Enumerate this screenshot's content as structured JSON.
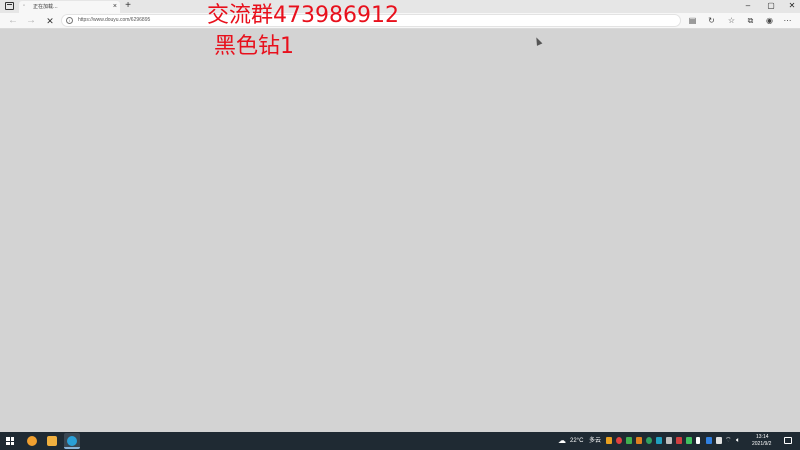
{
  "browser": {
    "tab_title": "正在加载...",
    "tab_close": "×",
    "new_tab": "+",
    "url": "https://www.douyu.com/6296895",
    "window_buttons": {
      "minimize": "–",
      "maximize": "▢",
      "close": "✕"
    },
    "nav": {
      "back": "←",
      "forward": "→",
      "stop": "✕"
    }
  },
  "overlay": {
    "line1": "交流群473986912",
    "line2": "黑色钻1"
  },
  "taskbar": {
    "weather": "22°C",
    "weather_desc": "多云",
    "time": "13:14",
    "date": "2021/9/2"
  },
  "colors": {
    "overlay_text": "#e8101c",
    "page_bg": "#d3d3d3",
    "taskbar_bg": "#1f2a33"
  }
}
